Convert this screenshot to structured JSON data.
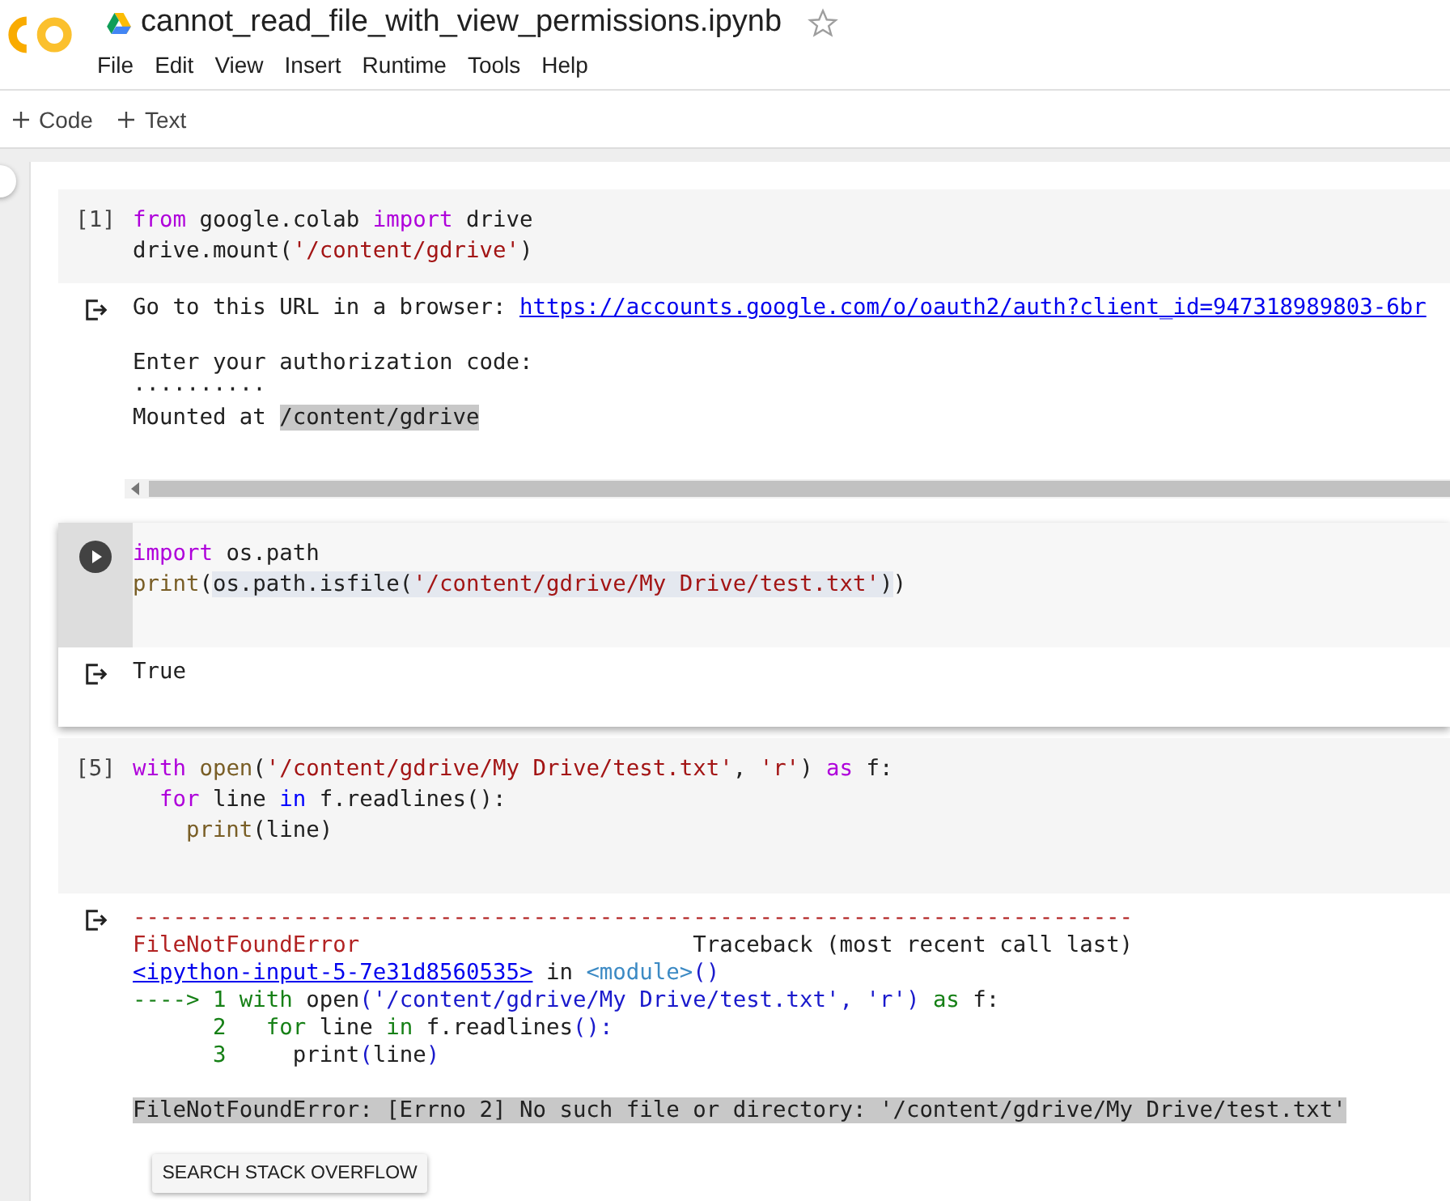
{
  "header": {
    "title": "cannot_read_file_with_view_permissions.ipynb",
    "starred": false,
    "menu": [
      "File",
      "Edit",
      "View",
      "Insert",
      "Runtime",
      "Tools",
      "Help"
    ]
  },
  "toolbar": {
    "buttons": [
      "Code",
      "Text"
    ]
  },
  "cells": [
    {
      "prompt": "[1]",
      "selected": false,
      "code": [
        [
          {
            "text": "from",
            "kind": "kw"
          },
          {
            "text": " google.colab ",
            "kind": "plain"
          },
          {
            "text": "import",
            "kind": "kw"
          },
          {
            "text": " drive",
            "kind": "plain"
          }
        ],
        [
          {
            "text": "drive.mount(",
            "kind": "plain"
          },
          {
            "text": "'/content/gdrive'",
            "kind": "str"
          },
          {
            "text": ")",
            "kind": "plain"
          }
        ]
      ],
      "output": {
        "kind": "stream",
        "blocks": [
          [
            [
              {
                "text": "Go to this URL in a browser: ",
                "kind": "plain"
              },
              {
                "text": "https://accounts.google.com/o/oauth2/auth?client_id=947318989803-6br",
                "kind": "link"
              }
            ]
          ],
          [
            [
              {
                "text": "Enter your authorization code:",
                "kind": "plain"
              }
            ],
            [
              {
                "text": "··········",
                "kind": "plain"
              }
            ],
            [
              {
                "text": "Mounted at ",
                "kind": "plain"
              },
              {
                "text": "/content/gdrive",
                "kind": "hl"
              }
            ]
          ]
        ]
      }
    },
    {
      "selected": true,
      "code": [
        [
          {
            "text": "import",
            "kind": "kw"
          },
          {
            "text": " os.path",
            "kind": "plain"
          }
        ],
        [
          {
            "text": "print",
            "kind": "fn"
          },
          {
            "text": "(",
            "kind": "plain"
          },
          {
            "kind": "match",
            "tokens": [
              {
                "text": "os.path.isfile(",
                "kind": "plain"
              },
              {
                "text": "'/content/gdrive/My Drive/test.txt'",
                "kind": "str"
              },
              {
                "text": ")",
                "kind": "plain"
              }
            ]
          },
          {
            "text": ")",
            "kind": "plain"
          }
        ]
      ],
      "output": {
        "kind": "result",
        "blocks": [
          [
            [
              {
                "text": "True",
                "kind": "plain"
              }
            ]
          ]
        ]
      }
    },
    {
      "prompt": "[5]",
      "selected": false,
      "code": [
        [
          {
            "text": "with",
            "kind": "kw"
          },
          {
            "text": " open",
            "kind": "fn"
          },
          {
            "text": "(",
            "kind": "plain"
          },
          {
            "text": "'/content/gdrive/My Drive/test.txt'",
            "kind": "str"
          },
          {
            "text": ", ",
            "kind": "plain"
          },
          {
            "text": "'r'",
            "kind": "str"
          },
          {
            "text": ") ",
            "kind": "plain"
          },
          {
            "text": "as",
            "kind": "kw"
          },
          {
            "text": " f:",
            "kind": "plain"
          }
        ],
        [
          {
            "text": "  for",
            "kind": "kw"
          },
          {
            "text": " line ",
            "kind": "plain"
          },
          {
            "text": "in",
            "kind": "op"
          },
          {
            "text": " f.readlines():",
            "kind": "plain"
          }
        ],
        [
          {
            "text": "    print",
            "kind": "fn"
          },
          {
            "text": "(line)",
            "kind": "plain"
          }
        ]
      ],
      "output": {
        "kind": "error",
        "button": "SEARCH STACK OVERFLOW",
        "blocks": [
          [
            [
              {
                "text": "---------------------------------------------------------------------------",
                "kind": "err"
              }
            ],
            [
              {
                "text": "FileNotFoundError",
                "kind": "err"
              },
              {
                "text": "                         Traceback (most recent call last)",
                "kind": "plain"
              }
            ],
            [
              {
                "text": "<ipython-input-5-7e31d8560535>",
                "kind": "link"
              },
              {
                "text": " in ",
                "kind": "plain"
              },
              {
                "text": "<module>",
                "kind": "module"
              },
              {
                "text": "()",
                "kind": "blue"
              }
            ],
            [
              {
                "text": "----> 1 with",
                "kind": "green"
              },
              {
                "text": " open",
                "kind": "plain"
              },
              {
                "text": "('/content/gdrive/My Drive/test.txt', 'r')",
                "kind": "blue"
              },
              {
                "text": " as",
                "kind": "green"
              },
              {
                "text": " f:",
                "kind": "plain"
              }
            ],
            [
              {
                "text": "      2   for",
                "kind": "green"
              },
              {
                "text": " line ",
                "kind": "plain"
              },
              {
                "text": "in",
                "kind": "green"
              },
              {
                "text": " f.readlines",
                "kind": "plain"
              },
              {
                "text": "():",
                "kind": "blue"
              }
            ],
            [
              {
                "text": "      3",
                "kind": "green"
              },
              {
                "text": "     print",
                "kind": "plain"
              },
              {
                "text": "(",
                "kind": "blue"
              },
              {
                "text": "line",
                "kind": "plain"
              },
              {
                "text": ")",
                "kind": "blue"
              }
            ]
          ],
          [
            [
              {
                "text": "FileNotFoundError: [Errno 2] No such file or directory: '/content/gdrive/My Drive/test.txt'",
                "kind": "hl"
              }
            ]
          ]
        ]
      }
    }
  ]
}
